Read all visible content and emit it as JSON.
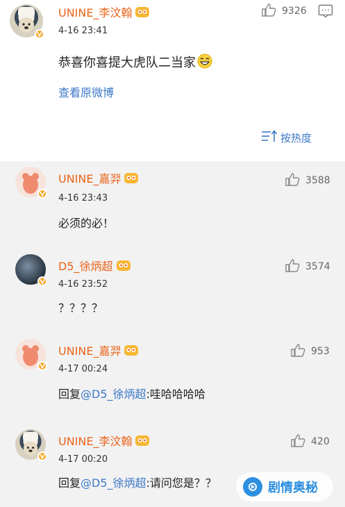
{
  "main_comment": {
    "username": "UNINE_李汶翰",
    "time": "4-16 23:41",
    "likes": "9326",
    "text": "恭喜你喜提大虎队二当家",
    "view_original": "查看原微博",
    "sort_label": "按热度"
  },
  "replies": [
    {
      "username": "UNINE_嘉羿",
      "time": "4-16 23:43",
      "likes": "3588",
      "text": "必须的必！"
    },
    {
      "username": "D5_徐炳超",
      "time": "4-16 23:52",
      "likes": "3574",
      "text": "？？？？"
    },
    {
      "username": "UNINE_嘉羿",
      "time": "4-17 00:24",
      "likes": "953",
      "reply_prefix": "回复",
      "mention": "@D5_徐炳超",
      "text": ":哇哈哈哈哈"
    },
    {
      "username": "UNINE_李汶翰",
      "time": "4-17 00:20",
      "likes": "420",
      "reply_prefix": "回复",
      "mention": "@D5_徐炳超",
      "text": ":请问您是？？"
    }
  ],
  "watermark": "剧情奥秘",
  "colors": {
    "username": "#e8641b",
    "link": "#3c78c8",
    "verified": "#f5a623",
    "reply_bg": "#f2f2f2"
  },
  "icons": [
    "thumbs-up-icon",
    "comment-icon",
    "verified-badge-icon",
    "crown-icon",
    "sort-icon",
    "laughing-emoji-icon"
  ]
}
